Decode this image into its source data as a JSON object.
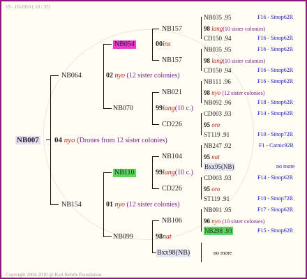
{
  "header_text": "19 - 10-2010 ( 10 : 37)",
  "footer_text": "Copyright 2004-2010 @ Karl Kehrle Foundation.",
  "root": {
    "label": "NB007",
    "gen_num": "04",
    "gen_word": "nyo",
    "note": "(Drones from 12 sister colonies)"
  },
  "nb064": {
    "label": "NB064",
    "gen_num": "02",
    "gen_word": "nyo",
    "note": "(12 sister colonies)"
  },
  "nb154": {
    "label": "NB154",
    "gen_num": "01",
    "gen_word": "nyo",
    "note": "(12 sister colonies)"
  },
  "nb054": {
    "label": "NB054",
    "gen_num": "00",
    "gen_word": "ins"
  },
  "nb070": {
    "label": "NB070",
    "gen_num": "99",
    "gen_word": "lang",
    "note": "(10 c.)"
  },
  "nb110": {
    "label": "NB110",
    "gen_num": "99",
    "gen_word": "lang",
    "note": "(10 c.)"
  },
  "nb099": {
    "label": "NB099",
    "gen_num": "98",
    "gen_word": "nat"
  },
  "nb157a": {
    "label": "NB157"
  },
  "nb157b": {
    "label": "NB157"
  },
  "nb021": {
    "label": "NB021"
  },
  "cd226a": {
    "label": "CD226"
  },
  "nb104": {
    "label": "NB104"
  },
  "cd226b": {
    "label": "CD226"
  },
  "nb106": {
    "label": "NB106"
  },
  "bxx98": {
    "label": "Bxx98(NB)"
  },
  "leaf": [
    {
      "id": "NB035",
      "val": ".95",
      "src": "F16 - Sinop62R"
    },
    {
      "num": "98",
      "word": "lang",
      "note": "(10 sister colonies)"
    },
    {
      "id": "CD150",
      "val": ".94",
      "src": "F16 - Sinop62R"
    },
    {
      "id": "NB035",
      "val": ".95",
      "src": "F16 - Sinop62R"
    },
    {
      "num": "98",
      "word": "lang",
      "note": "(10 sister colonies)"
    },
    {
      "id": "CD150",
      "val": ".94",
      "src": "F16 - Sinop62R"
    },
    {
      "id": "NB111",
      "val": ".96",
      "src": "F16 - Sinop62R"
    },
    {
      "num": "98",
      "word": "nyo",
      "note": "(12 sister colonies)"
    },
    {
      "id": "NB092",
      "val": ".96",
      "src": "F18 - Sinop62R"
    },
    {
      "id": "CD003",
      "val": ".93",
      "src": "F14 - Sinop62R"
    },
    {
      "num": "95",
      "word": "oro"
    },
    {
      "id": "ST119",
      "val": ".91",
      "src": "F10 - Sinop72R"
    },
    {
      "id": "NB247",
      "val": ".92",
      "src": "F1 - Carnic92R"
    },
    {
      "num": "95",
      "word": "nat"
    },
    {
      "id": "Bxx95(NB)",
      "src": "no more"
    },
    {
      "id": "CD003",
      "val": ".93",
      "src": "F14 - Sinop62R"
    },
    {
      "num": "95",
      "word": "oro"
    },
    {
      "id": "ST119",
      "val": ".91",
      "src": "F10 - Sinop72R"
    },
    {
      "id": "NB091",
      "val": ".95",
      "src": "F17 - Sinop62R"
    },
    {
      "num": "96",
      "word": "nyo",
      "note": "(10 sister colonies)"
    },
    {
      "id": "NB298",
      "val": ".93",
      "src": "F15 - Sinop62R"
    },
    {
      "src": "no more"
    }
  ]
}
